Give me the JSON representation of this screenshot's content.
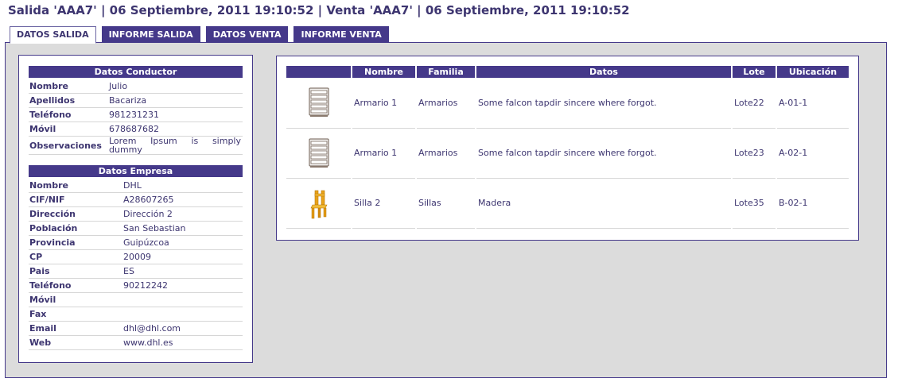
{
  "title": "Salida 'AAA7' | 06 Septiembre, 2011 19:10:52 | Venta 'AAA7' | 06 Septiembre, 2011 19:10:52",
  "tabs": [
    {
      "label": "DATOS SALIDA"
    },
    {
      "label": "INFORME SALIDA"
    },
    {
      "label": "DATOS VENTA"
    },
    {
      "label": "INFORME VENTA"
    }
  ],
  "conductor": {
    "heading": "Datos Conductor",
    "rows": [
      {
        "label": "Nombre",
        "value": "Julio"
      },
      {
        "label": "Apellidos",
        "value": "Bacariza"
      },
      {
        "label": "Teléfono",
        "value": "981231231"
      },
      {
        "label": "Móvil",
        "value": "678687682"
      },
      {
        "label": "Observaciones",
        "value": "Lorem Ipsum is simply dummy"
      }
    ]
  },
  "empresa": {
    "heading": "Datos Empresa",
    "rows": [
      {
        "label": "Nombre",
        "value": "DHL"
      },
      {
        "label": "CIF/NIF",
        "value": "A28607265"
      },
      {
        "label": "Dirección",
        "value": "Dirección 2"
      },
      {
        "label": "Población",
        "value": "San Sebastian"
      },
      {
        "label": "Provincia",
        "value": "Guipúzcoa"
      },
      {
        "label": "CP",
        "value": "20009"
      },
      {
        "label": "Pais",
        "value": "ES"
      },
      {
        "label": "Teléfono",
        "value": "90212242"
      },
      {
        "label": "Móvil",
        "value": ""
      },
      {
        "label": "Fax",
        "value": ""
      },
      {
        "label": "Email",
        "value": "dhl@dhl.com"
      },
      {
        "label": "Web",
        "value": "www.dhl.es"
      }
    ]
  },
  "products": {
    "columns": [
      "",
      "Nombre",
      "Familia",
      "Datos",
      "Lote",
      "Ubicación"
    ],
    "rows": [
      {
        "icon": "cabinet-icon",
        "nombre": "Armario 1",
        "familia": "Armarios",
        "datos": "Some falcon tapdir sincere where forgot.",
        "lote": "Lote22",
        "ubicacion": "A-01-1"
      },
      {
        "icon": "cabinet-icon",
        "nombre": "Armario 1",
        "familia": "Armarios",
        "datos": "Some falcon tapdir sincere where forgot.",
        "lote": "Lote23",
        "ubicacion": "A-02-1"
      },
      {
        "icon": "chair-icon",
        "nombre": "Silla 2",
        "familia": "Sillas",
        "datos": "Madera",
        "lote": "Lote35",
        "ubicacion": "B-02-1"
      }
    ]
  },
  "colors": {
    "accent": "#45398a",
    "text": "#3d3570",
    "panel_bg": "#dcdcdc"
  }
}
